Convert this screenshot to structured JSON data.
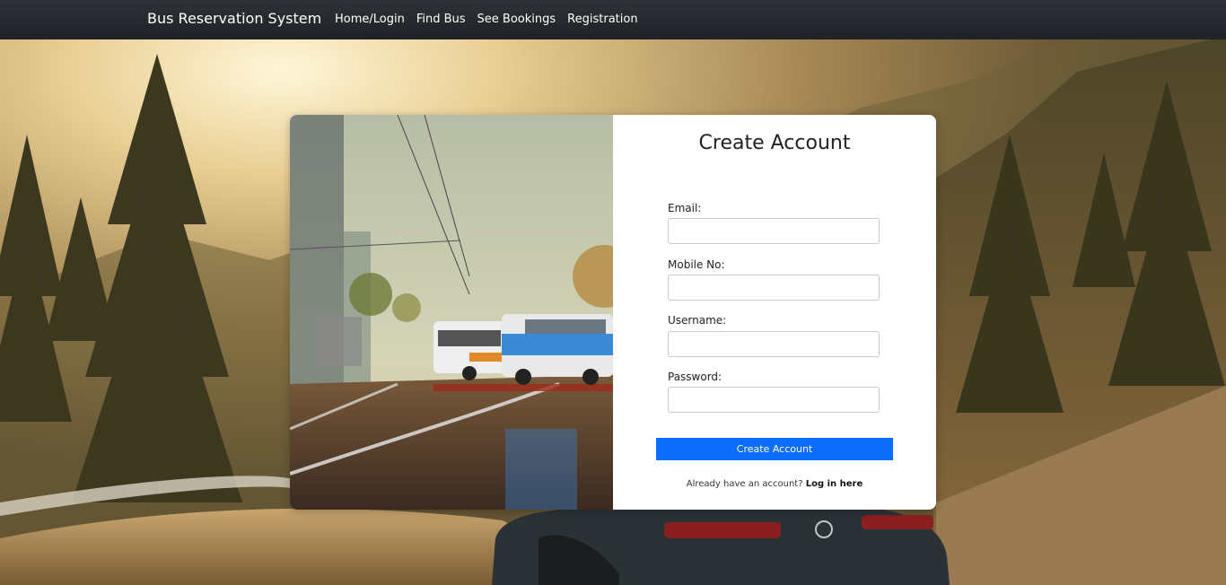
{
  "navbar": {
    "brand": "Bus Reservation System",
    "links": [
      {
        "label": "Home/Login"
      },
      {
        "label": "Find Bus"
      },
      {
        "label": "See Bookings"
      },
      {
        "label": "Registration"
      }
    ]
  },
  "form": {
    "title": "Create Account",
    "fields": [
      {
        "label": "Email:",
        "value": ""
      },
      {
        "label": "Mobile No:",
        "value": ""
      },
      {
        "label": "Username:",
        "value": ""
      },
      {
        "label": "Password:",
        "value": ""
      }
    ],
    "submit_label": "Create Account",
    "login_prompt": "Already have an account?",
    "login_link": "Log in here"
  },
  "colors": {
    "navbar": "#2a2d31",
    "primary_button": "#0d6efd",
    "card_background": "#ffffff"
  }
}
